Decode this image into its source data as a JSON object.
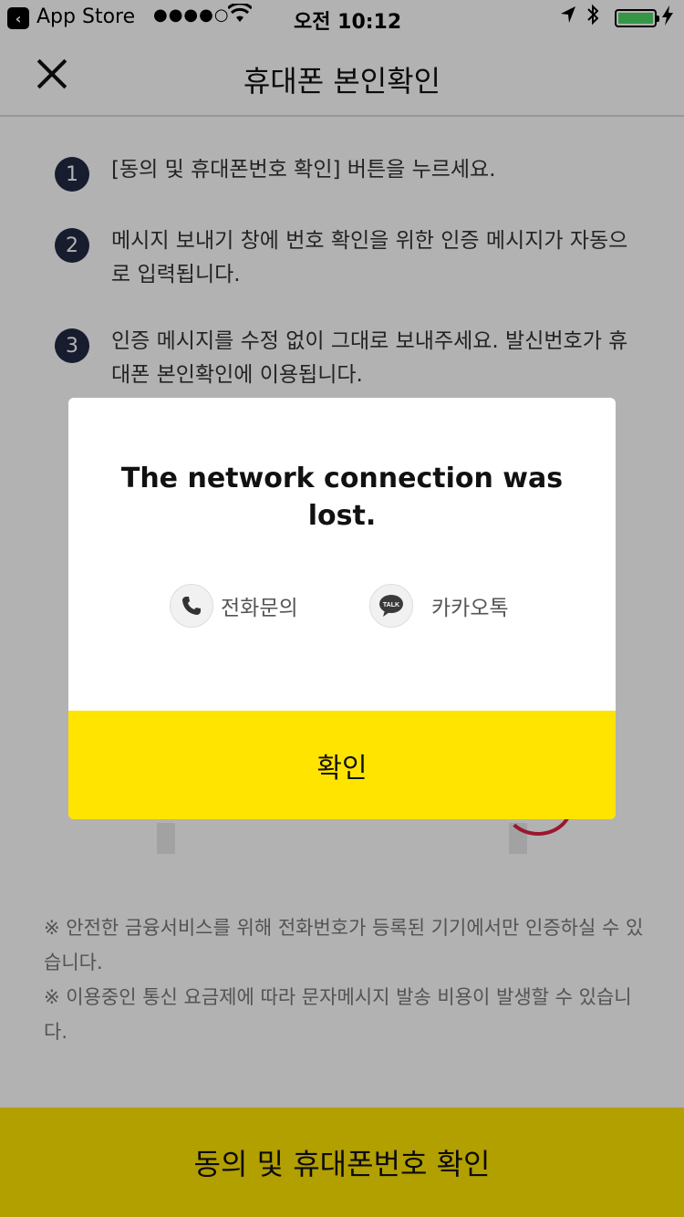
{
  "status_bar": {
    "back_app": "App Store",
    "signal": "●●●●○",
    "time": "오전 10:12",
    "battery_level": 1.0
  },
  "nav": {
    "title": "휴대폰 본인확인"
  },
  "steps": [
    {
      "num": "1",
      "text": "[동의 및 휴대폰번호 확인] 버튼을 누르세요."
    },
    {
      "num": "2",
      "text": "메시지 보내기 창에 번호 확인을 위한 인증 메시지가 자동으로 입력됩니다."
    },
    {
      "num": "3",
      "text": "인증 메시지를 수정 없이 그대로 보내주세요. 발신번호가 휴대폰 본인확인에 이용됩니다."
    }
  ],
  "notes": [
    "※ 안전한 금융서비스를 위해 전화번호가 등록된 기기에서만 인증하실 수 있습니다.",
    "※ 이용중인 통신 요금제에 따라 문자메시지 발송 비용이 발생할 수 있습니다."
  ],
  "bottom_button": "동의 및 휴대폰번호 확인",
  "dialog": {
    "message": "The network connection was lost.",
    "phone_label": "전화문의",
    "kakao_label": "카카오톡",
    "kakao_icon_text": "TALK",
    "confirm_label": "확인"
  },
  "colors": {
    "accent_yellow": "#ffe400",
    "step_badge": "#222a44",
    "battery_green": "#4cd964"
  }
}
